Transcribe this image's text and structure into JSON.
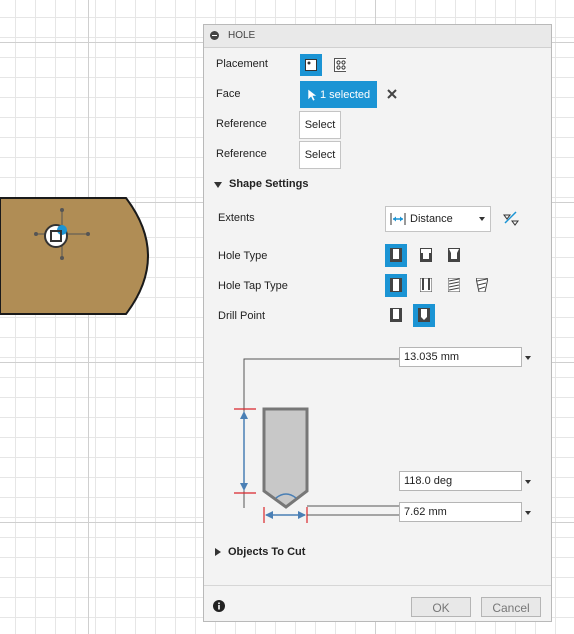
{
  "panel": {
    "title": "HOLE",
    "placement_label": "Placement",
    "face_label": "Face",
    "face_value": "1 selected",
    "reference1_label": "Reference",
    "reference1_button": "Select",
    "reference2_label": "Reference",
    "reference2_button": "Select"
  },
  "shape_settings": {
    "title": "Shape Settings",
    "extents_label": "Extents",
    "extents_value": "Distance",
    "hole_type_label": "Hole Type",
    "hole_tap_type_label": "Hole Tap Type",
    "drill_point_label": "Drill Point"
  },
  "dimensions": {
    "depth": "13.035 mm",
    "angle": "118.0 deg",
    "diameter": "7.62 mm"
  },
  "objects_to_cut": {
    "title": "Objects To Cut"
  },
  "footer": {
    "ok": "OK",
    "cancel": "Cancel"
  },
  "colors": {
    "accent": "#1b94d4",
    "body": "#b08d55",
    "dimension": "#4a7fb5",
    "extent": "#d9262b"
  },
  "icons": [
    "placement-single-icon",
    "placement-multi-icon",
    "cursor-icon",
    "close-icon",
    "distance-icon",
    "flip-icon",
    "info-icon"
  ]
}
